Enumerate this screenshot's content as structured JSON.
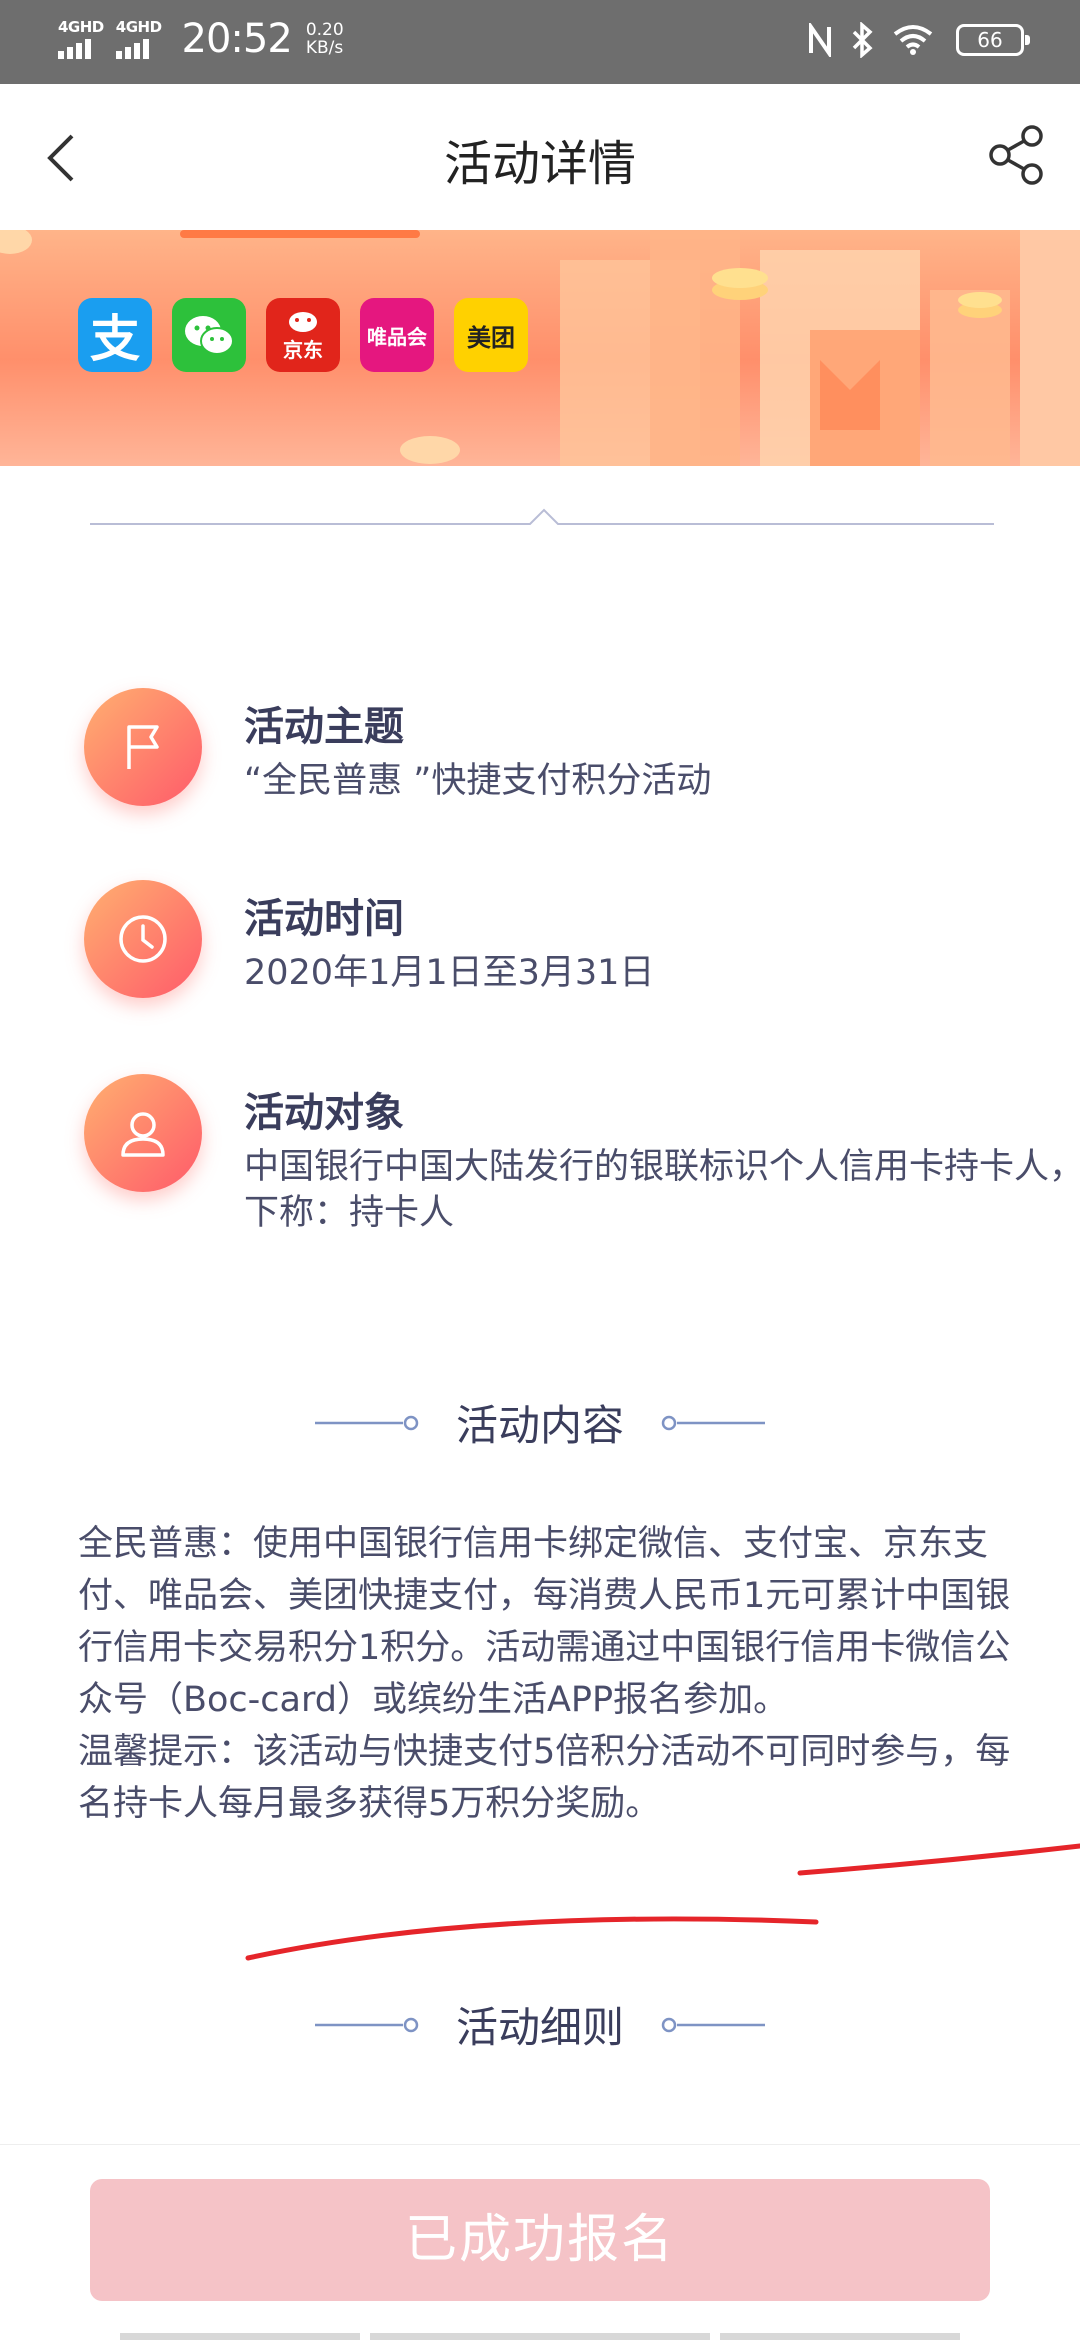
{
  "status_bar": {
    "signal_1": "4GHD",
    "signal_2": "4GHD",
    "time": "20:52",
    "speed_value": "0.20",
    "speed_unit": "KB/s",
    "battery": "66",
    "icons": [
      "nfc-icon",
      "bluetooth-icon",
      "wifi-icon",
      "battery-icon"
    ]
  },
  "header": {
    "title": "活动详情",
    "back_icon": "chevron-left-icon",
    "share_icon": "share-icon"
  },
  "banner": {
    "apps": [
      {
        "name": "alipay",
        "glyph": "支",
        "color": "#1a9ef0"
      },
      {
        "name": "wechat",
        "glyph": "",
        "color": "#2dc13b"
      },
      {
        "name": "jd",
        "glyph": "京东",
        "color": "#e1251b"
      },
      {
        "name": "vip",
        "glyph": "唯品会",
        "color": "#e5177f"
      },
      {
        "name": "meituan",
        "glyph": "美团",
        "color": "#ffd100"
      }
    ]
  },
  "info": {
    "theme": {
      "label": "活动主题",
      "value": "“全民普惠 ”快捷支付积分活动",
      "icon": "flag-icon"
    },
    "time": {
      "label": "活动时间",
      "value": "2020年1月1日至3月31日",
      "icon": "clock-icon"
    },
    "target": {
      "label": "活动对象",
      "value": "中国银行中国大陆发行的银联标识个人信用卡持卡人，下称：持卡人",
      "icon": "user-icon"
    }
  },
  "sections": {
    "content_title": "活动内容",
    "rules_title": "活动细则"
  },
  "content": {
    "paragraph": "全民普惠：使用中国银行信用卡绑定微信、支付宝、京东支付、唯品会、美团快捷支付，每消费人民币1元可累计中国银行信用卡交易积分1积分。活动需通过中国银行信用卡微信公众号（Boc-card）或缤纷生活APP报名参加。",
    "tip": "温馨提示：该活动与快捷支付5倍积分活动不可同时参与，每名持卡人每月最多获得5万积分奖励。"
  },
  "bottom": {
    "button_label": "已成功报名"
  },
  "colors": {
    "accent_gradient_start": "#ffb070",
    "accent_gradient_end": "#ff5a6a",
    "button_disabled": "#f5c3c7",
    "annotation_red": "#e5252a",
    "text_primary": "#3a3d5c"
  }
}
